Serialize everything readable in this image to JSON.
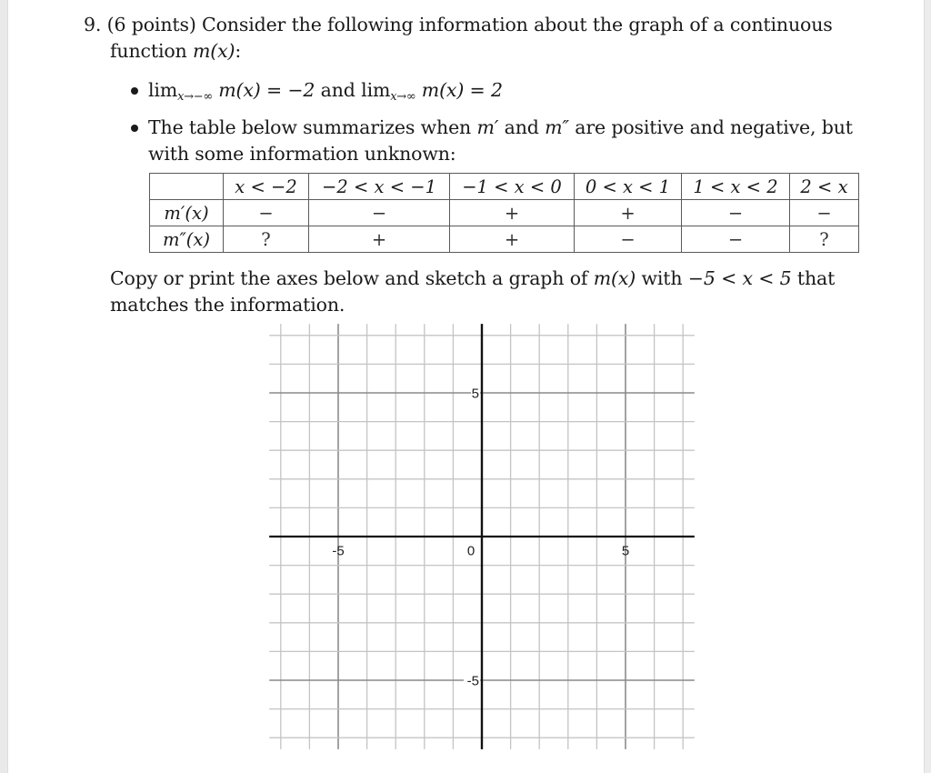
{
  "problem": {
    "number": "9.",
    "intro_line1": "(6 points) Consider the following information about the graph of a continuous",
    "intro_line2_prefix": "function ",
    "function_name": "m(x)",
    "intro_line2_suffix": ":"
  },
  "bullets": [
    {
      "lim_word_1": "lim",
      "lim_sub_1": "x→−∞",
      "expr_1": "m(x) = −2",
      "and": " and ",
      "lim_word_2": "lim",
      "lim_sub_2": "x→∞",
      "expr_2": "m(x) = 2"
    },
    {
      "line1_a": "The table below summarizes when ",
      "m_prime": "m′",
      "line1_b": " and ",
      "m_double_prime": "m″",
      "line1_c": " are positive and negative, but",
      "line2": "with some information unknown:"
    }
  ],
  "table": {
    "columns": [
      "",
      "x < −2",
      "−2 < x < −1",
      "−1 < x < 0",
      "0 < x < 1",
      "1 < x < 2",
      "2 < x"
    ],
    "rows": [
      {
        "label": "m′(x)",
        "values": [
          "−",
          "−",
          "+",
          "+",
          "−",
          "−"
        ]
      },
      {
        "label": "m″(x)",
        "values": [
          "?",
          "+",
          "+",
          "−",
          "−",
          "?"
        ]
      }
    ]
  },
  "instruction": {
    "line1_a": "Copy or print the axes below and sketch a graph of ",
    "func": "m(x)",
    "line1_b": " with ",
    "range": "−5 < x < 5",
    "line1_c": " that",
    "line2": "matches the information."
  },
  "graph": {
    "x_range": [
      -7.4,
      7.4
    ],
    "y_range": [
      -7.4,
      7.4
    ],
    "grid_step": 1,
    "x_tick_labels": [
      {
        "value": -5,
        "text": "-5"
      },
      {
        "value": 0,
        "text": "0"
      },
      {
        "value": 5,
        "text": "5"
      }
    ],
    "y_tick_labels": [
      {
        "value": 5,
        "text": "5"
      },
      {
        "value": -5,
        "text": "-5"
      }
    ],
    "colors": {
      "grid": "#c4c4c4",
      "major": "#8a8a8a",
      "axis": "#111111"
    }
  }
}
